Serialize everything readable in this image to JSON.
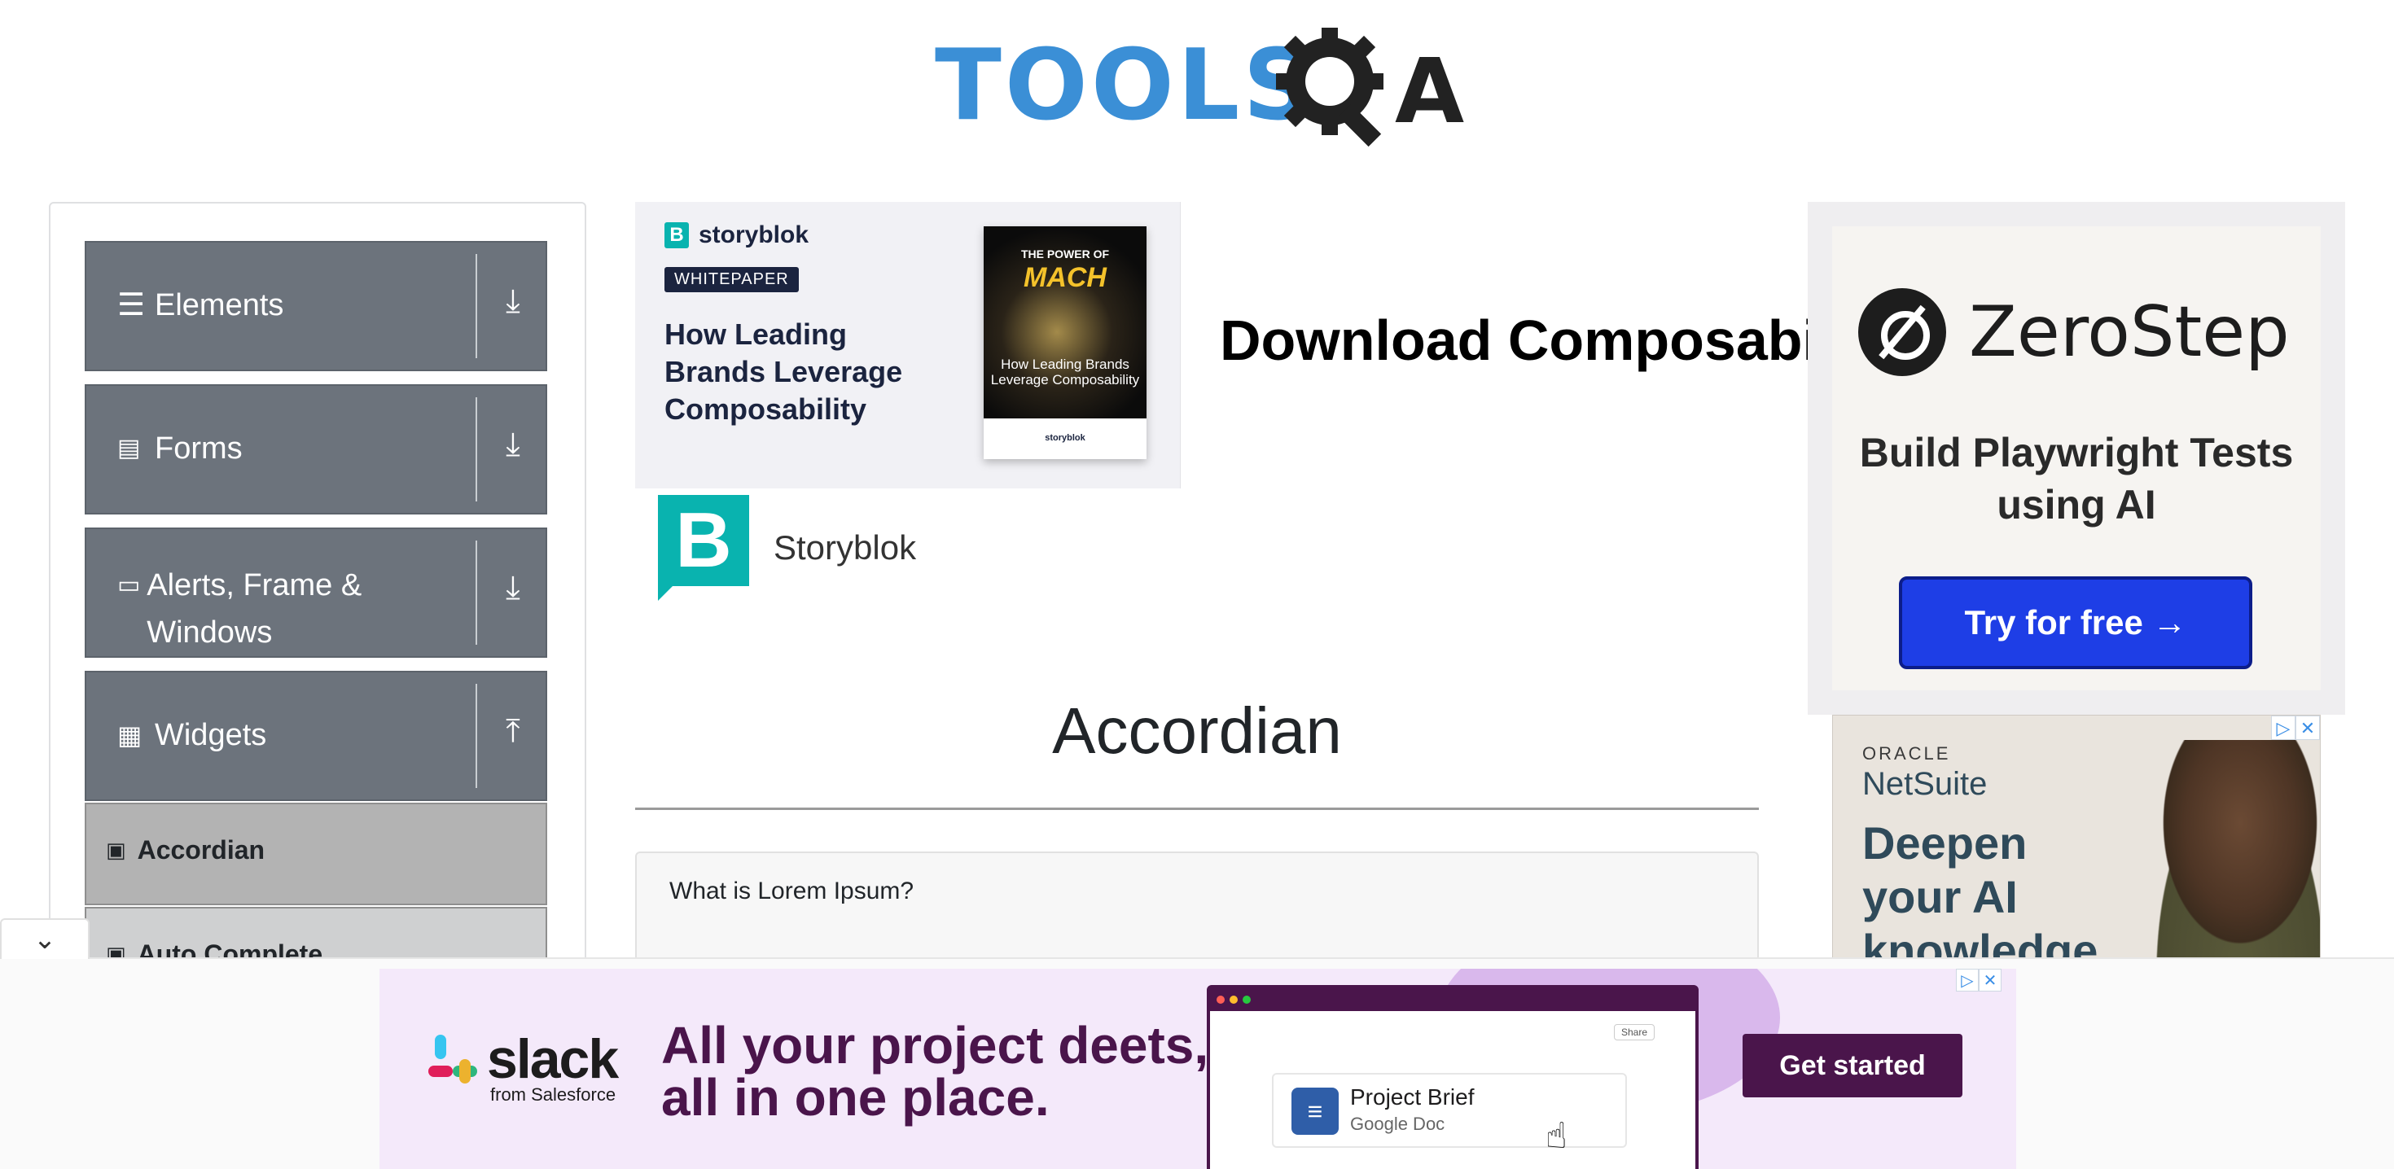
{
  "header": {
    "logo_text": "TOOLSQA"
  },
  "sidebar": {
    "groups": [
      {
        "label": "Elements",
        "icon": "menu-icon",
        "arrow": "⤓"
      },
      {
        "label": "Forms",
        "icon": "form-icon",
        "arrow": "⤓"
      },
      {
        "label": "Alerts, Frame & Windows",
        "icon": "window-icon",
        "arrow": "⤓"
      },
      {
        "label": "Widgets",
        "icon": "widgets-icon",
        "arrow": "⤒"
      }
    ],
    "items": [
      {
        "label": "Accordian",
        "active": true
      },
      {
        "label": "Auto Complete",
        "active": false
      }
    ]
  },
  "ad_top": {
    "brand": "storyblok",
    "badge": "WHITEPAPER",
    "headline": "How Leading Brands Leverage Composability",
    "book_top": "THE POWER OF",
    "book_mach": "MACH",
    "book_title": "How Leading Brands Leverage Composability",
    "book_footer": "storyblok",
    "download_text": "Download Composabil",
    "sponsor_name": "Storyblok"
  },
  "main": {
    "title": "Accordian",
    "sections": [
      {
        "question": "What is Lorem Ipsum?"
      }
    ]
  },
  "ad_zerostep": {
    "brand": "ZeroStep",
    "tagline": "Build Playwright Tests using AI",
    "cta": "Try for free →"
  },
  "ad_oracle": {
    "company": "ORACLE",
    "product": "NetSuite",
    "headline": "Deepen your AI knowledge"
  },
  "ad_bottom": {
    "brand": "slack",
    "from": "from Salesforce",
    "headline_line1": "All your project deets,",
    "headline_line2": "all in one place.",
    "share": "Share",
    "doc_title": "Project Brief",
    "doc_type": "Google Doc",
    "cta": "Get started"
  },
  "collapse_icon": "chevron-down-icon",
  "colors": {
    "sidebar_group_bg": "#6c737c",
    "sidebar_active_bg": "#b3b3b3",
    "zerostep_button": "#1e3ee6",
    "slack_purple": "#4a154b",
    "logo_blue": "#3b8fd6"
  }
}
